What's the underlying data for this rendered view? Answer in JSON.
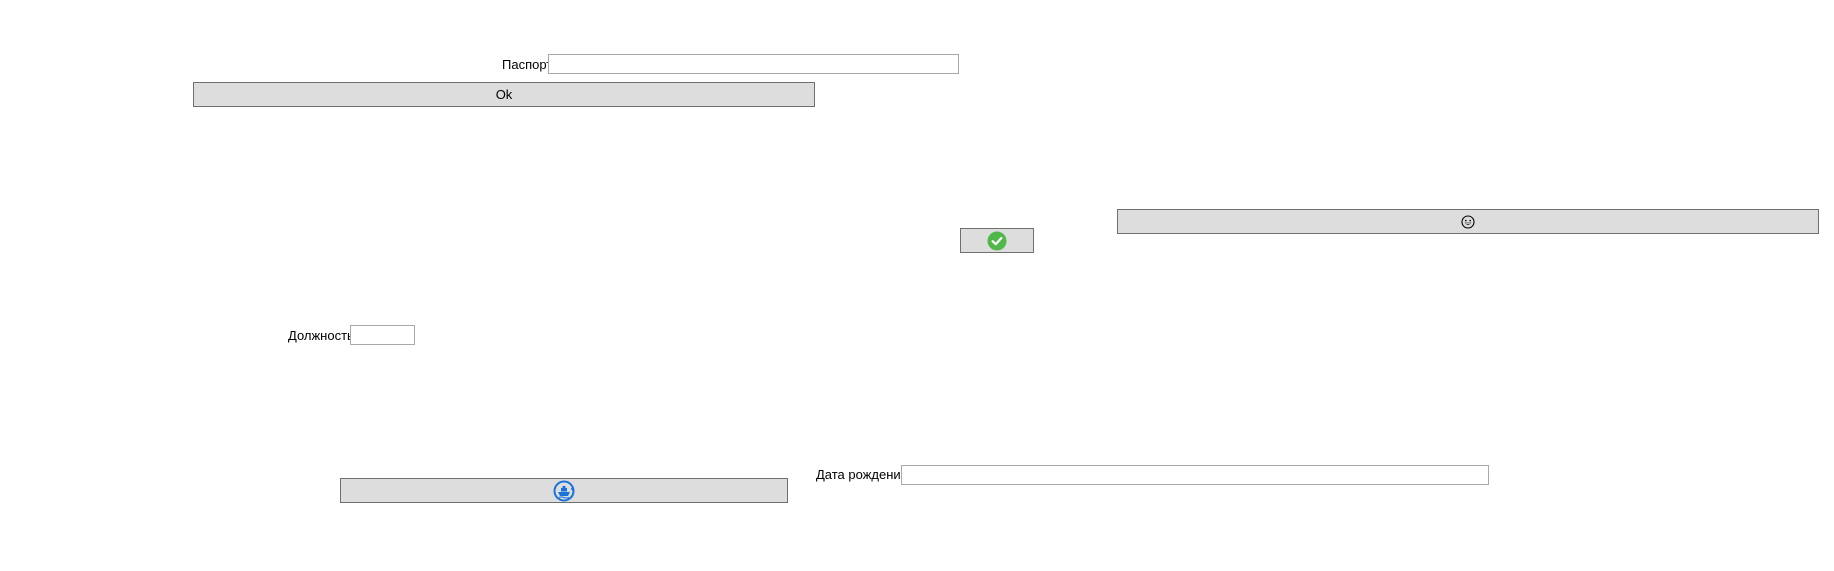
{
  "form": {
    "passport_label": "Паспорт",
    "passport_value": "",
    "ok_button_label": "Ok",
    "position_label": "Должность",
    "position_value": "",
    "birthdate_label": "Дата рождения",
    "birthdate_value": ""
  },
  "icons": {
    "confirm_button_icon": "check-circle-icon",
    "face_button_icon": "grinning-face-icon",
    "ship_button_icon": "ship-icon"
  },
  "colors": {
    "button_bg": "#dddddd",
    "button_border": "#707070",
    "field_border": "#a9a9a9",
    "check_green": "#4fb848",
    "ship_blue": "#1a73d9"
  }
}
